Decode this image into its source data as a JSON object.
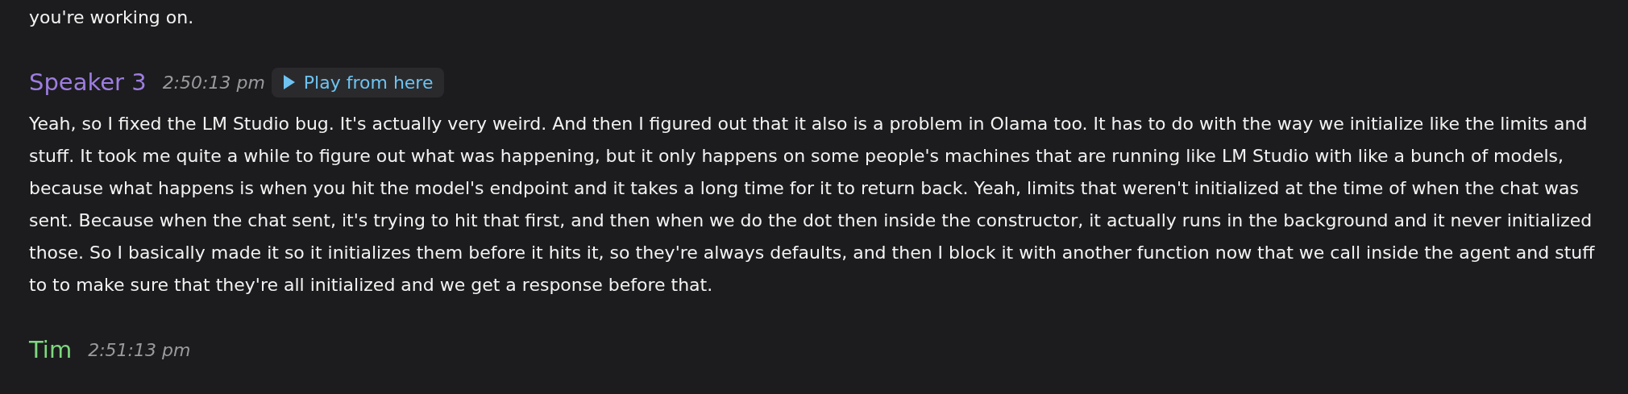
{
  "entries": [
    {
      "text": "you're working on."
    },
    {
      "speaker": "Speaker 3",
      "color": "#9d7ee0",
      "time": "2:50:13 pm",
      "play_button": "Play from here",
      "text": "Yeah, so I fixed the LM Studio bug. It's actually very weird. And then I figured out that it also is a problem in Olama too. It has to do with the way we initialize like the limits and stuff. It took me quite a while to figure out what was happening, but it only happens on some people's machines that are running like LM Studio with like a bunch of models, because what happens is when you hit the model's endpoint and it takes a long time for it to return back. Yeah, limits that weren't initialized at the time of when the chat was sent. Because when the chat sent, it's trying to hit that first, and then when we do the dot then inside the constructor, it actually runs in the background and it never initialized those. So I basically made it so it initializes them before it hits it, so they're always defaults, and then I block it with another function now that we call inside the agent and stuff to to make sure that they're all initialized and we get a response before that."
    },
    {
      "speaker": "Tim",
      "color": "#7fd87f",
      "time": "2:51:13 pm"
    }
  ]
}
